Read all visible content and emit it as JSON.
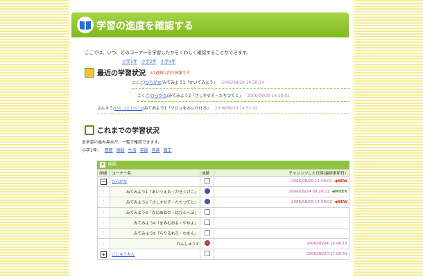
{
  "header": {
    "title": "学習の進度を確認する"
  },
  "intro": "ここでは、いつ、どのコーナーを学習したかをくわしく確認することができます。",
  "grades": [
    "小学1年",
    "小学2年",
    "小学4年"
  ],
  "recent_section": {
    "title": "最近の学習状況",
    "note": "※1週間以内の情報です",
    "items": [
      {
        "prefix": "こくご/",
        "name": "ひらがな",
        "text": "/みてみよう1「かいてみよう」",
        "date": "2006/08/29 14:58:14"
      },
      {
        "prefix": "こくご/",
        "name": "ひらがな",
        "text": "/みてみよう2「さしすせそ・たちつてと」",
        "date": "2006/08/29 14:58:02"
      },
      {
        "prefix": "さんすう/",
        "name": "いくつといくつ",
        "text": "/みてみよう1「マロンをおいかけろ」",
        "date": "2006/08/29 14:53:43"
      }
    ]
  },
  "history_section": {
    "title": "これまでの学習状況",
    "desc": "全学習の進み具合が、一覧で確認できます。",
    "grade_label": "小学1年：",
    "subjects": [
      "算数",
      "国語",
      "生活",
      "英語",
      "音楽",
      "図工"
    ],
    "table": {
      "caption": "国語",
      "headers": [
        "詳細",
        "コーナー名",
        "成績",
        "チャレンジした日時(最終更新日)"
      ],
      "rows": [
        {
          "toggle": "−",
          "name": "ひらがな",
          "kind": "parent",
          "status": "box",
          "date": "2006/08/29 14:58:02",
          "badge": "◀NEW",
          "badge_color": "#e0301e"
        },
        {
          "toggle": "",
          "name": "みてみよう1「あいうえお・かきくけこ」",
          "kind": "child",
          "status": "blue",
          "date": "2006/08/24 08:26:12",
          "badge": "◀WEEK",
          "badge_color": "#3aa02a"
        },
        {
          "toggle": "",
          "name": "みてみよう2「さしすせそ・たちつてと」",
          "kind": "child",
          "status": "blue",
          "date": "2006/08/29 14:58:02",
          "badge": "◀NEW",
          "badge_color": "#e0301e"
        },
        {
          "toggle": "",
          "name": "みてみよう3「なにぬねの・はひふへほ」",
          "kind": "child",
          "status": "box",
          "date": "",
          "badge": "",
          "badge_color": ""
        },
        {
          "toggle": "",
          "name": "みてみよう4「まみむめも・やゆよ」",
          "kind": "child",
          "status": "box",
          "date": "",
          "badge": "",
          "badge_color": ""
        },
        {
          "toggle": "",
          "name": "みてみよう5「らりるれろ・わをん」",
          "kind": "child",
          "status": "box",
          "date": "",
          "badge": "",
          "badge_color": ""
        },
        {
          "toggle": "",
          "name": "れんしゅう1",
          "kind": "child",
          "status": "red",
          "date": "2006/08/04 15:46:15",
          "badge": "",
          "badge_color": ""
        },
        {
          "toggle": "+",
          "name": "ごじゅうおん",
          "kind": "parent",
          "status": "box",
          "date": "2006/08/20 17:08:51",
          "badge": "",
          "badge_color": ""
        }
      ]
    }
  },
  "colors": {
    "accent_green": "#8ec43f",
    "stripe_yellow": "#f5ec8e",
    "link_blue": "#3366cc",
    "dot_blue": "#2a5bd7",
    "dot_red": "#e03c2a"
  }
}
